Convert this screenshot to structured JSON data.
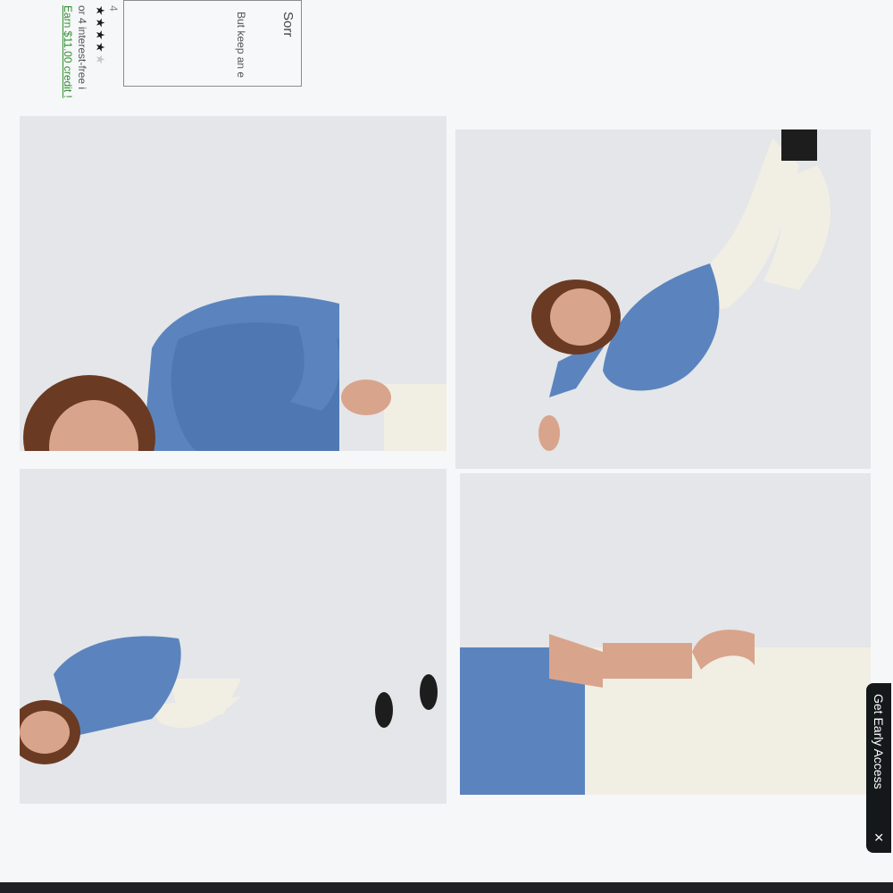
{
  "product": {
    "rating_stars": "★★★★",
    "rating_dim_star": "★",
    "review_count": "4",
    "afterpay_text": "or 4 interest-free i",
    "credit_text": "Earn $11.00 credit !"
  },
  "notice": {
    "title": "Sorr",
    "body": "But keep an e"
  },
  "gallery": {
    "images": [
      {
        "alt": "Model in blue sweatshirt, portrait crop"
      },
      {
        "alt": "Model seated on floor in blue sweatshirt and white jeans"
      },
      {
        "alt": "Model standing in blue sweatshirt and white jeans, full length"
      },
      {
        "alt": "Close-up of blue sweatshirt hem and white jeans"
      }
    ]
  },
  "early_access": {
    "label": "Get Early Access",
    "close": "×"
  },
  "colors": {
    "sweater": "#5b84be",
    "jeans": "#f1eee4",
    "hair": "#6b3a22",
    "skin": "#d9a48c",
    "background": "#e4e6e9"
  }
}
